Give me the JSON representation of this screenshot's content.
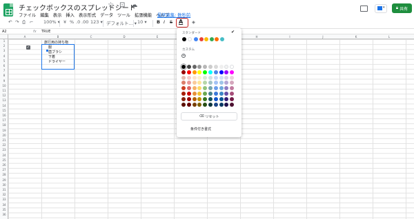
{
  "app": {
    "title": "チェックボックスのスプレッドシート",
    "last_edit": "最終編集: 数秒前",
    "share_label": "共有"
  },
  "menu": [
    "ファイル",
    "編集",
    "表示",
    "挿入",
    "表示形式",
    "データ",
    "ツール",
    "拡張機能",
    "ヘルプ"
  ],
  "toolbar": {
    "zoom": "100%",
    "currency": "¥",
    "percent": "%",
    "decimal_less": ".0",
    "decimal_more": ".00",
    "format_123": "123",
    "font": "デフォルト...",
    "font_size": "10",
    "bold": "B",
    "italic": "I",
    "strike": "S",
    "text_color": "A"
  },
  "formula_bar": {
    "cell_ref": "A2",
    "fx": "fx",
    "value": "TRUE"
  },
  "columns": [
    "A",
    "B",
    "C",
    "D",
    "E",
    "F",
    "G",
    "H",
    "I",
    "J",
    "K",
    "L"
  ],
  "rows": [
    "1",
    "2",
    "3",
    "4",
    "5",
    "6",
    "7",
    "8",
    "9",
    "10",
    "11",
    "12",
    "13",
    "14",
    "15",
    "16",
    "17",
    "18",
    "19",
    "20",
    "21",
    "22",
    "23",
    "24",
    "25",
    "26",
    "27",
    "28",
    "29",
    "30",
    "31",
    "32",
    "33",
    "34",
    "35",
    "36"
  ],
  "cells": {
    "b1": "旅行用の持ち物",
    "b2": "服",
    "b3": "歯ブラシ",
    "b4": "下着",
    "b5": "ドライヤー",
    "a2_check": "✓"
  },
  "palette": {
    "standard_label": "スタンダード",
    "custom_label": "カスタム",
    "add_symbol": "+",
    "selected_check": "✔",
    "reset_label": "リセット",
    "conditional_label": "条件付き書式",
    "standard_colors": [
      "#000000",
      "#ffffff",
      "#4285f4",
      "#ea4335",
      "#fbbc04",
      "#34a853",
      "#ff6d01",
      "#46bdc6"
    ],
    "grid_colors": [
      "#000000",
      "#434343",
      "#666666",
      "#999999",
      "#b7b7b7",
      "#cccccc",
      "#d9d9d9",
      "#efefef",
      "#f3f3f3",
      "#ffffff",
      "#980000",
      "#ff0000",
      "#ff9900",
      "#ffff00",
      "#00ff00",
      "#00ffff",
      "#4a86e8",
      "#0000ff",
      "#9900ff",
      "#ff00ff",
      "#e6b8af",
      "#f4cccc",
      "#fce5cd",
      "#fff2cc",
      "#d9ead3",
      "#d0e0e3",
      "#c9daf8",
      "#cfe2f3",
      "#d9d2e9",
      "#ead1dc",
      "#dd7e6b",
      "#ea9999",
      "#f9cb9c",
      "#ffe599",
      "#b6d7a8",
      "#a2c4c9",
      "#a4c2f4",
      "#9fc5e8",
      "#b4a7d6",
      "#d5a6bd",
      "#cc4125",
      "#e06666",
      "#f6b26b",
      "#ffd966",
      "#93c47d",
      "#76a5af",
      "#6d9eeb",
      "#6fa8dc",
      "#8e7cc3",
      "#c27ba0",
      "#a61c00",
      "#cc0000",
      "#e69138",
      "#f1c232",
      "#6aa84f",
      "#45818e",
      "#3c78d8",
      "#3d85c6",
      "#674ea7",
      "#a64d79",
      "#85200c",
      "#990000",
      "#b45f06",
      "#bf9000",
      "#38761d",
      "#134f5c",
      "#1155cc",
      "#0b5394",
      "#351c75",
      "#741b47",
      "#5b0f00",
      "#660000",
      "#783f04",
      "#7f6000",
      "#274e13",
      "#0c343d",
      "#1c4587",
      "#073763",
      "#20124d",
      "#4c1130"
    ]
  }
}
